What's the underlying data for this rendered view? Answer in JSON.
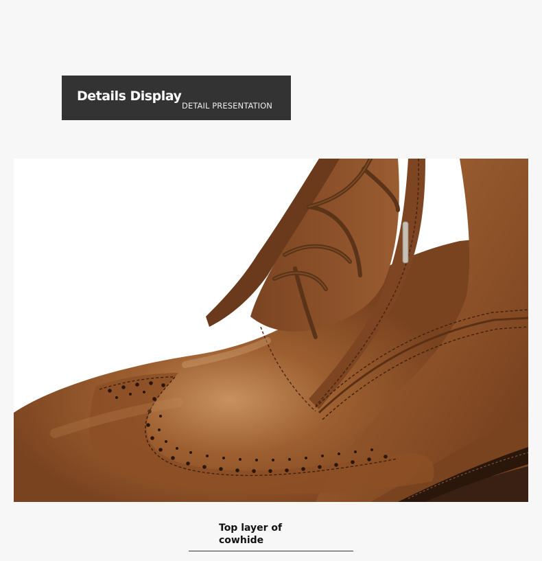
{
  "banner": {
    "title": "Details Display",
    "subtitle": "DETAIL PRESENTATION"
  },
  "photo": {
    "subject": "brown-leather-brogue-boot-closeup",
    "colors": {
      "leather": "#8a4f27",
      "leather_dark": "#5e3216",
      "lace": "#5a3318",
      "background": "#ffffff"
    }
  },
  "caption": {
    "text": "Top layer of cowhide"
  }
}
